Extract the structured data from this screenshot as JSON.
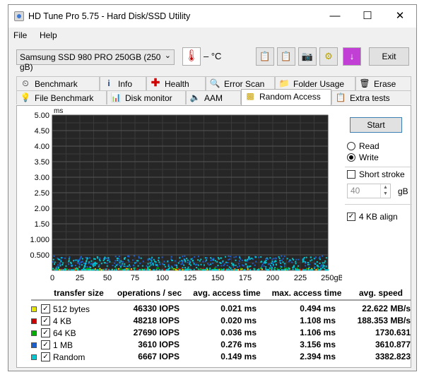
{
  "window": {
    "title": "HD Tune Pro 5.75 - Hard Disk/SSD Utility"
  },
  "menu": {
    "file": "File",
    "help": "Help"
  },
  "toolbar": {
    "drive": "Samsung SSD 980 PRO 250GB (250 gB)",
    "temperature": "– °C",
    "exit_label": "Exit"
  },
  "tabs_row1": [
    {
      "label": "Benchmark",
      "icon": "benchmark-icon"
    },
    {
      "label": "Info",
      "icon": "info-icon"
    },
    {
      "label": "Health",
      "icon": "health-cross-icon"
    },
    {
      "label": "Error Scan",
      "icon": "magnifier-icon"
    },
    {
      "label": "Folder Usage",
      "icon": "folder-icon"
    },
    {
      "label": "Erase",
      "icon": "trash-icon"
    }
  ],
  "tabs_row2": [
    {
      "label": "File Benchmark",
      "icon": "file-benchmark-icon"
    },
    {
      "label": "Disk monitor",
      "icon": "disk-monitor-icon"
    },
    {
      "label": "AAM",
      "icon": "speaker-icon"
    },
    {
      "label": "Random Access",
      "icon": "random-access-icon"
    },
    {
      "label": "Extra tests",
      "icon": "extra-tests-icon"
    }
  ],
  "controls": {
    "start_label": "Start",
    "read_label": "Read",
    "write_label": "Write",
    "mode_selected": "Write",
    "short_stroke_label": "Short stroke",
    "short_stroke_checked": false,
    "stroke_value": "40",
    "stroke_unit": "gB",
    "align_label": "4 KB align",
    "align_checked": true
  },
  "chart_data": {
    "type": "scatter",
    "ylabel": "ms",
    "ylim": [
      0,
      5.0
    ],
    "xlim": [
      0,
      250
    ],
    "y_ticks": [
      "5.00",
      "4.50",
      "4.00",
      "3.50",
      "3.00",
      "2.50",
      "2.00",
      "1.50",
      "1.000",
      "0.500"
    ],
    "y_tick_values": [
      5.0,
      4.5,
      4.0,
      3.5,
      3.0,
      2.5,
      2.0,
      1.5,
      1.0,
      0.5
    ],
    "x_ticks": [
      "0",
      "25",
      "50",
      "75",
      "100",
      "125",
      "150",
      "175",
      "200",
      "225",
      "250gB"
    ],
    "x_tick_values": [
      0,
      25,
      50,
      75,
      100,
      125,
      150,
      175,
      200,
      225,
      250
    ],
    "grid": true,
    "background": "#262626",
    "series": [
      {
        "name": "512 bytes",
        "color": "#e6e600",
        "approx_y": 0.021
      },
      {
        "name": "4 KB",
        "color": "#cc0000",
        "approx_y": 0.02
      },
      {
        "name": "64 KB",
        "color": "#00b000",
        "approx_y": 0.036
      },
      {
        "name": "1 MB",
        "color": "#1a5fd0",
        "approx_y": 0.276
      },
      {
        "name": "Random",
        "color": "#00c8d0",
        "approx_y": 0.149
      }
    ]
  },
  "results": {
    "headers": [
      "transfer size",
      "operations / sec",
      "avg. access time",
      "max. access time",
      "avg. speed"
    ],
    "rows": [
      {
        "name": "512 bytes",
        "color": "#e6e600",
        "ops": "46330 IOPS",
        "avg": "0.021 ms",
        "max": "0.494 ms",
        "speed": "22.622 MB/s"
      },
      {
        "name": "4 KB",
        "color": "#cc0000",
        "ops": "48218 IOPS",
        "avg": "0.020 ms",
        "max": "1.108 ms",
        "speed": "188.353 MB/s"
      },
      {
        "name": "64 KB",
        "color": "#00b000",
        "ops": "27690 IOPS",
        "avg": "0.036 ms",
        "max": "1.106 ms",
        "speed": "1730.631"
      },
      {
        "name": "1 MB",
        "color": "#1a5fd0",
        "ops": "3610 IOPS",
        "avg": "0.276 ms",
        "max": "3.156 ms",
        "speed": "3610.877"
      },
      {
        "name": "Random",
        "color": "#00c8d0",
        "ops": "6667 IOPS",
        "avg": "0.149 ms",
        "max": "2.394 ms",
        "speed": "3382.823"
      }
    ]
  }
}
